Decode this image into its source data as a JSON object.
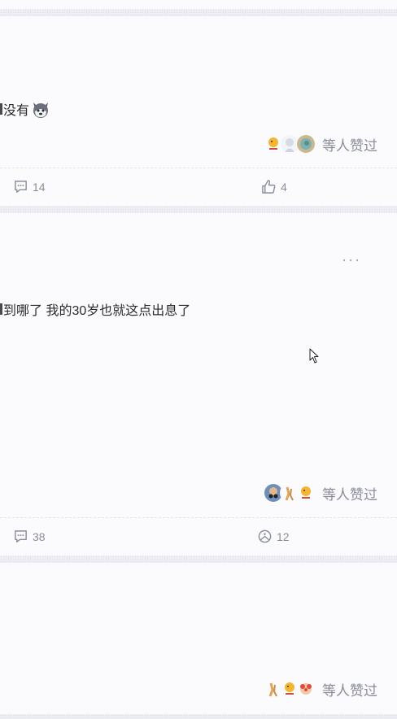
{
  "cards": [
    {
      "text": "没有",
      "emoji": "husky-face-icon",
      "likers_label": "等人赞过",
      "comment_count": "14",
      "like_count": "4"
    },
    {
      "text": "到哪了 我的30岁也就这点出息了",
      "more_label": "···",
      "likers_label": "等人赞过",
      "comment_count": "38",
      "collect_count": "12"
    },
    {
      "likers_label": "等人赞过"
    }
  ],
  "colors": {
    "background": "#fbfbfe",
    "separator": "#eeeff4",
    "muted_text": "#8a8d99",
    "body_text": "#2b2b2b"
  }
}
